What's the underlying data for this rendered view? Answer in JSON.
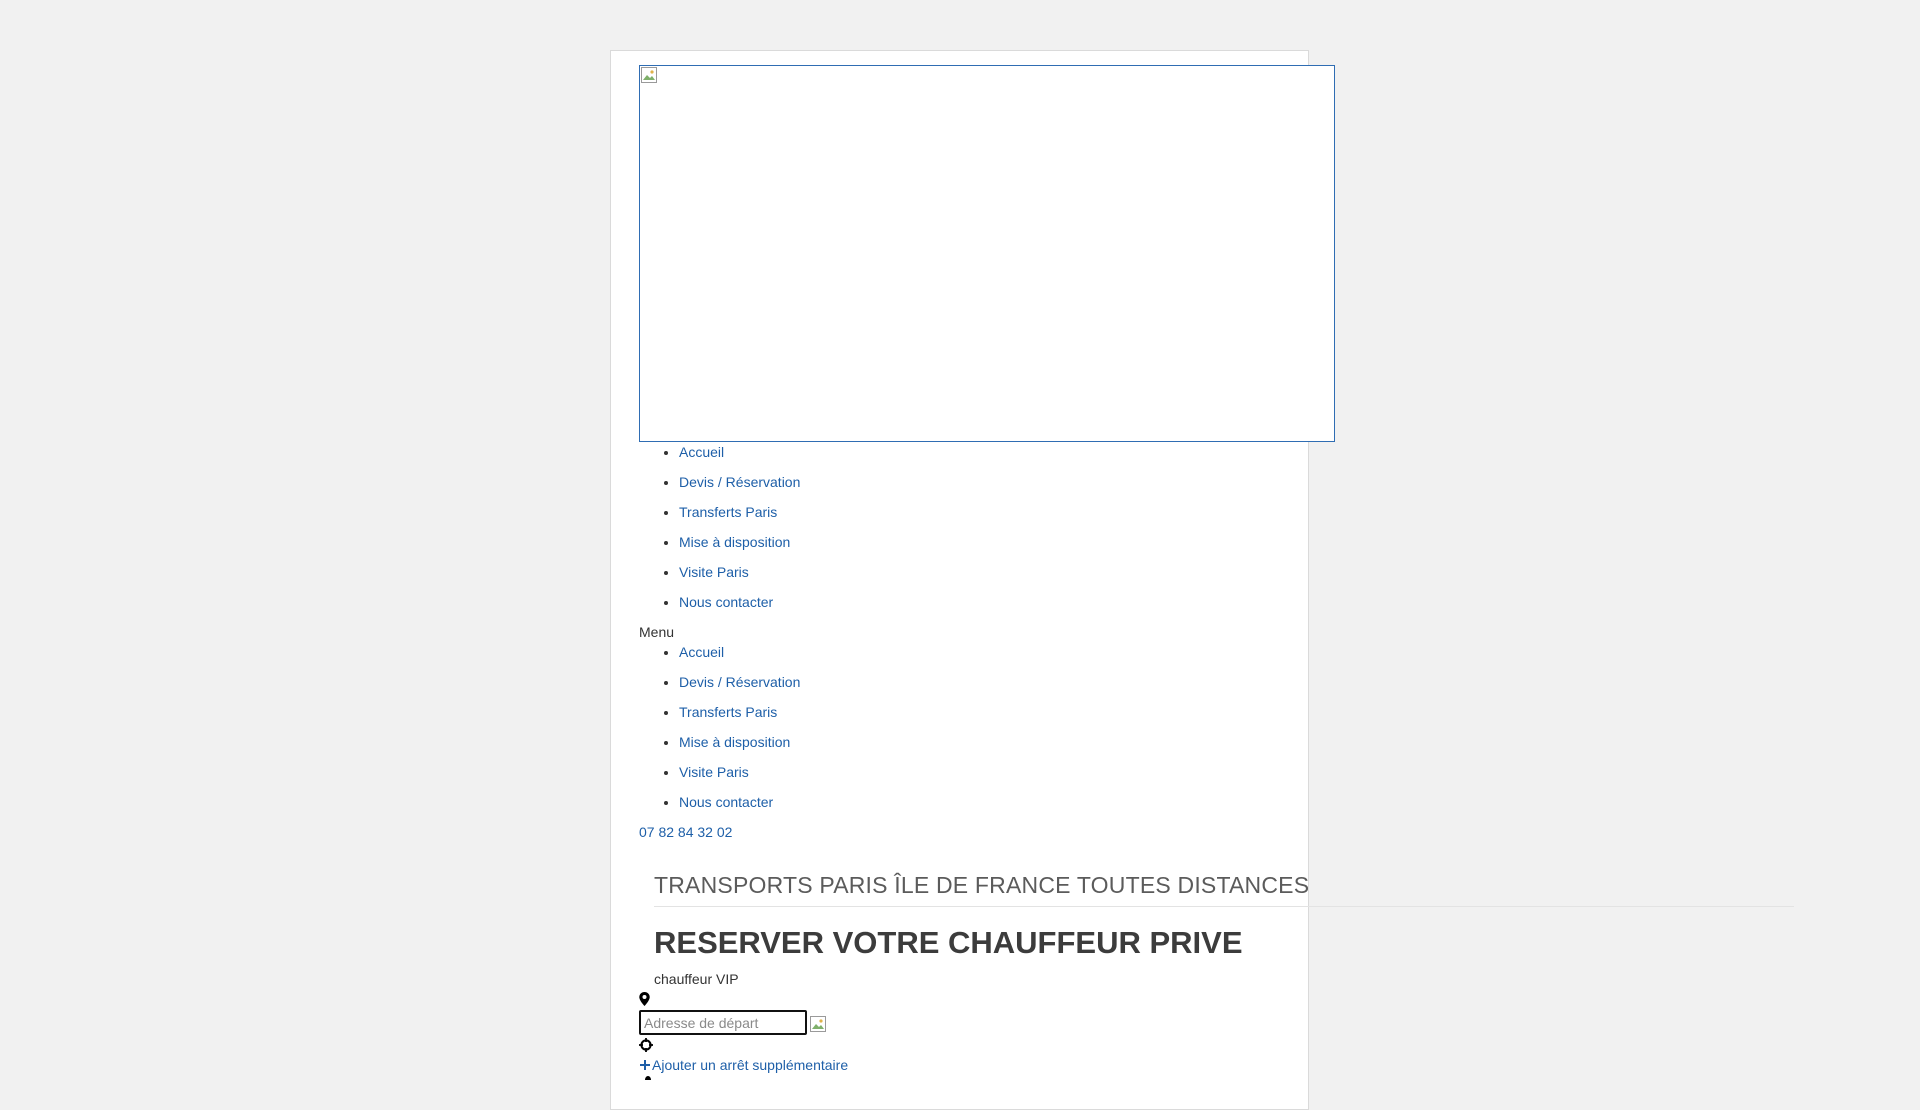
{
  "nav_top": [
    {
      "label": "Accueil"
    },
    {
      "label": "Devis / Réservation"
    },
    {
      "label": "Transferts Paris"
    },
    {
      "label": "Mise à disposition"
    },
    {
      "label": "Visite Paris"
    },
    {
      "label": "Nous contacter"
    }
  ],
  "menu_label": "Menu",
  "nav_bottom": [
    {
      "label": "Accueil"
    },
    {
      "label": "Devis / Réservation"
    },
    {
      "label": "Transferts Paris"
    },
    {
      "label": "Mise à disposition"
    },
    {
      "label": "Visite Paris"
    },
    {
      "label": "Nous contacter"
    }
  ],
  "phone": "07 82 84 32 02",
  "subtitle": "TRANSPORTS PARIS ÎLE DE FRANCE TOUTES DISTANCES",
  "main_title": "RESERVER VOTRE CHAUFFEUR PRIVE",
  "tagline": "chauffeur VIP",
  "booking": {
    "departure_placeholder": "Adresse de départ",
    "departure_value": "",
    "add_stop_label": "Ajouter un arrêt supplémentaire"
  },
  "colors": {
    "background": "#f1f1f1",
    "link": "#1e5fa8",
    "frame_border": "#2f6db3"
  },
  "icons": {
    "pin": "map-marker-icon",
    "crosshair": "crosshair-icon",
    "plus": "plus-icon",
    "broken_image": "broken-image-icon"
  }
}
